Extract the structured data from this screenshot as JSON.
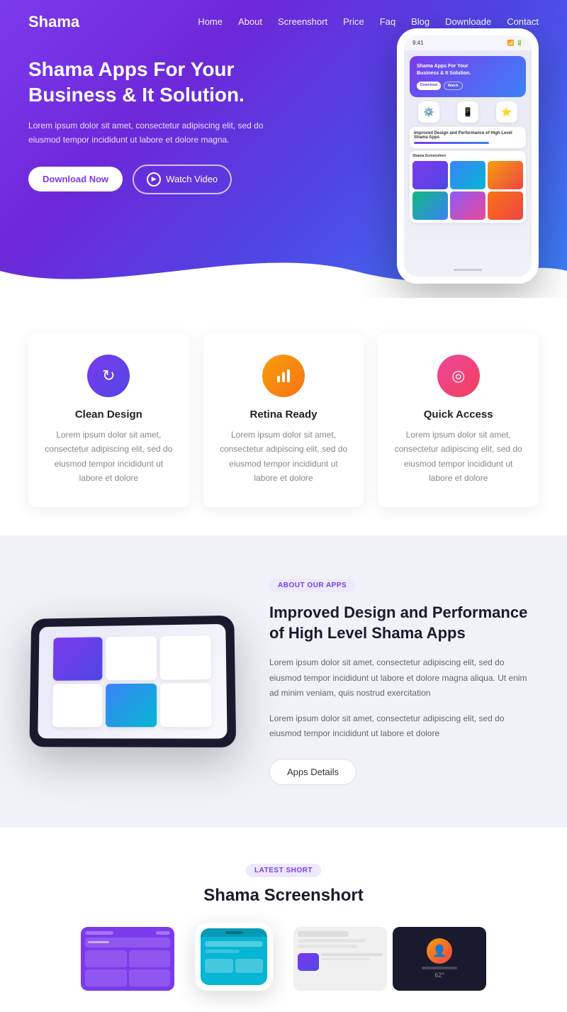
{
  "brand": {
    "name": "Shama"
  },
  "nav": {
    "links": [
      {
        "label": "Home",
        "href": "#"
      },
      {
        "label": "About",
        "href": "#"
      },
      {
        "label": "Screenshort",
        "href": "#"
      },
      {
        "label": "Price",
        "href": "#"
      },
      {
        "label": "Faq",
        "href": "#"
      },
      {
        "label": "Blog",
        "href": "#"
      },
      {
        "label": "Downloade",
        "href": "#"
      },
      {
        "label": "Contact",
        "href": "#"
      }
    ]
  },
  "hero": {
    "title": "Shama Apps For Your Business & It Solution.",
    "description": "Lorem ipsum dolor sit amet, consectetur adipiscing elit, sed do eiusmod tempor incididunt ut labore et dolore magna.",
    "btn_download": "Download Now",
    "btn_watch": "Watch Video",
    "phone_time": "9:41"
  },
  "features": {
    "items": [
      {
        "icon": "↻",
        "icon_type": "purple",
        "title": "Clean Design",
        "desc": "Lorem ipsum dolor sit amet, consectetur adipiscing elit, sed do eiusmod tempor incididunt ut labore et dolore"
      },
      {
        "icon": "📊",
        "icon_type": "orange",
        "title": "Retina Ready",
        "desc": "Lorem ipsum dolor sit amet, consectetur adipiscing elit, sed do eiusmod tempor incididunt ut labore et dolore"
      },
      {
        "icon": "◎",
        "icon_type": "pink",
        "title": "Quick Access",
        "desc": "Lorem ipsum dolor sit amet, consectetur adipiscing elit, sed do eiusmod tempor incididunt ut labore et dolore"
      }
    ]
  },
  "about": {
    "badge": "About Our Apps",
    "title": "Improved Design and Performance of High Level Shama Apps",
    "desc1": "Lorem ipsum dolor sit amet, consectetur adipiscing elit, sed do eiusmod tempor incididunt ut labore et dolore magna aliqua. Ut enim ad minim veniam, quis nostrud exercitation",
    "desc2": "Lorem ipsum dolor sit amet, consectetur adipiscing elit, sed do eiusmod tempor incididunt ut labore et dolore",
    "btn": "Apps Details"
  },
  "screenshots": {
    "badge": "Latest Short",
    "title": "Shama Screenshort"
  }
}
